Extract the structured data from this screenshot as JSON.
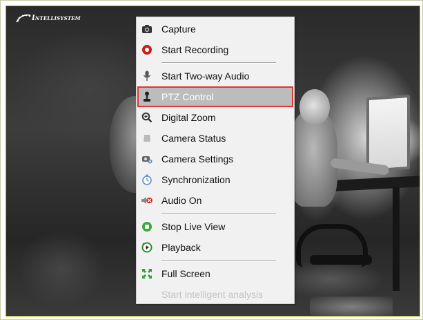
{
  "logo": {
    "text": "Intellisystem"
  },
  "menu": {
    "items": [
      {
        "label": "Capture",
        "icon": "camera-icon"
      },
      {
        "label": "Start Recording",
        "icon": "record-icon"
      },
      {
        "label": "Start Two-way Audio",
        "icon": "microphone-icon"
      },
      {
        "label": "PTZ Control",
        "icon": "joystick-icon",
        "highlighted": true
      },
      {
        "label": "Digital Zoom",
        "icon": "zoom-icon"
      },
      {
        "label": "Camera Status",
        "icon": "status-icon"
      },
      {
        "label": "Camera Settings",
        "icon": "settings-icon"
      },
      {
        "label": "Synchronization",
        "icon": "sync-icon"
      },
      {
        "label": "Audio On",
        "icon": "speaker-icon"
      },
      {
        "label": "Stop Live View",
        "icon": "stop-live-icon"
      },
      {
        "label": "Playback",
        "icon": "playback-icon"
      },
      {
        "label": "Full Screen",
        "icon": "fullscreen-icon"
      },
      {
        "label": "Start intelligent analysis",
        "icon": "",
        "disabled": true
      }
    ]
  },
  "colors": {
    "highlight_border": "#e03535",
    "highlight_bg": "#bcbcbc",
    "menu_bg": "#f1f1f1",
    "viewport_border": "#a9b000"
  }
}
